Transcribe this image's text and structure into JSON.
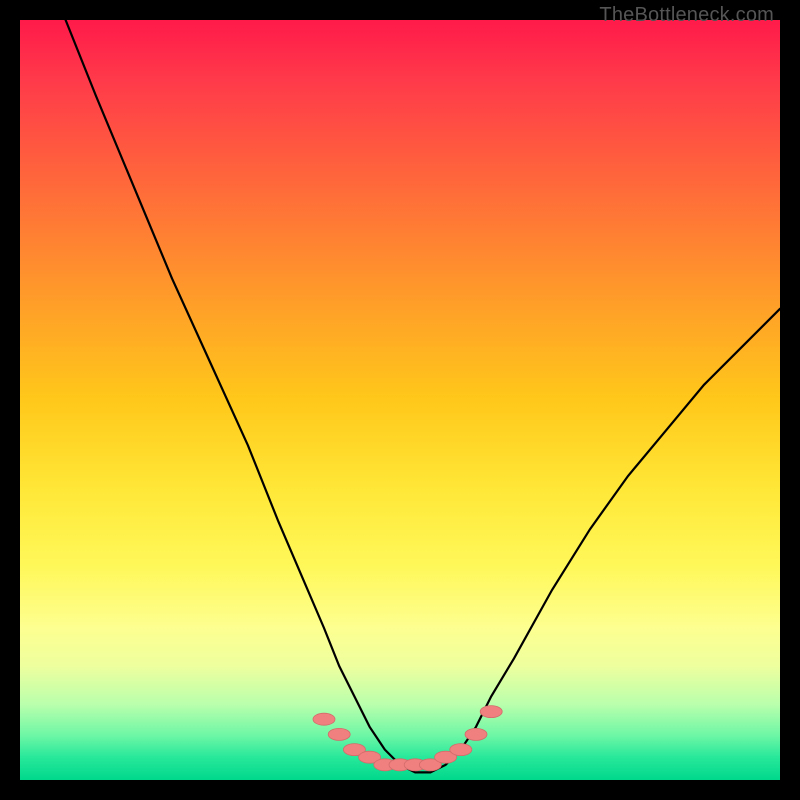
{
  "watermark": "TheBottleneck.com",
  "chart_data": {
    "type": "line",
    "title": "",
    "xlabel": "",
    "ylabel": "",
    "xlim": [
      0,
      100
    ],
    "ylim": [
      0,
      100
    ],
    "series": [
      {
        "name": "curve",
        "x": [
          6,
          10,
          15,
          20,
          25,
          30,
          34,
          37,
          40,
          42,
          44,
          46,
          48,
          50,
          52,
          54,
          56,
          58,
          60,
          62,
          65,
          70,
          75,
          80,
          85,
          90,
          95,
          100
        ],
        "y": [
          100,
          90,
          78,
          66,
          55,
          44,
          34,
          27,
          20,
          15,
          11,
          7,
          4,
          2,
          1,
          1,
          2,
          4,
          7,
          11,
          16,
          25,
          33,
          40,
          46,
          52,
          57,
          62
        ]
      }
    ],
    "markers": {
      "name": "bottleneck-points",
      "x": [
        40,
        42,
        44,
        46,
        48,
        50,
        52,
        54,
        56,
        58,
        60,
        62
      ],
      "y": [
        8,
        6,
        4,
        3,
        2,
        2,
        2,
        2,
        3,
        4,
        6,
        9
      ]
    },
    "gradient_stops": [
      {
        "pos": 0.0,
        "color": "#ff1a4a"
      },
      {
        "pos": 0.5,
        "color": "#ffe838"
      },
      {
        "pos": 0.85,
        "color": "#eeff9e"
      },
      {
        "pos": 1.0,
        "color": "#00d88c"
      }
    ]
  }
}
